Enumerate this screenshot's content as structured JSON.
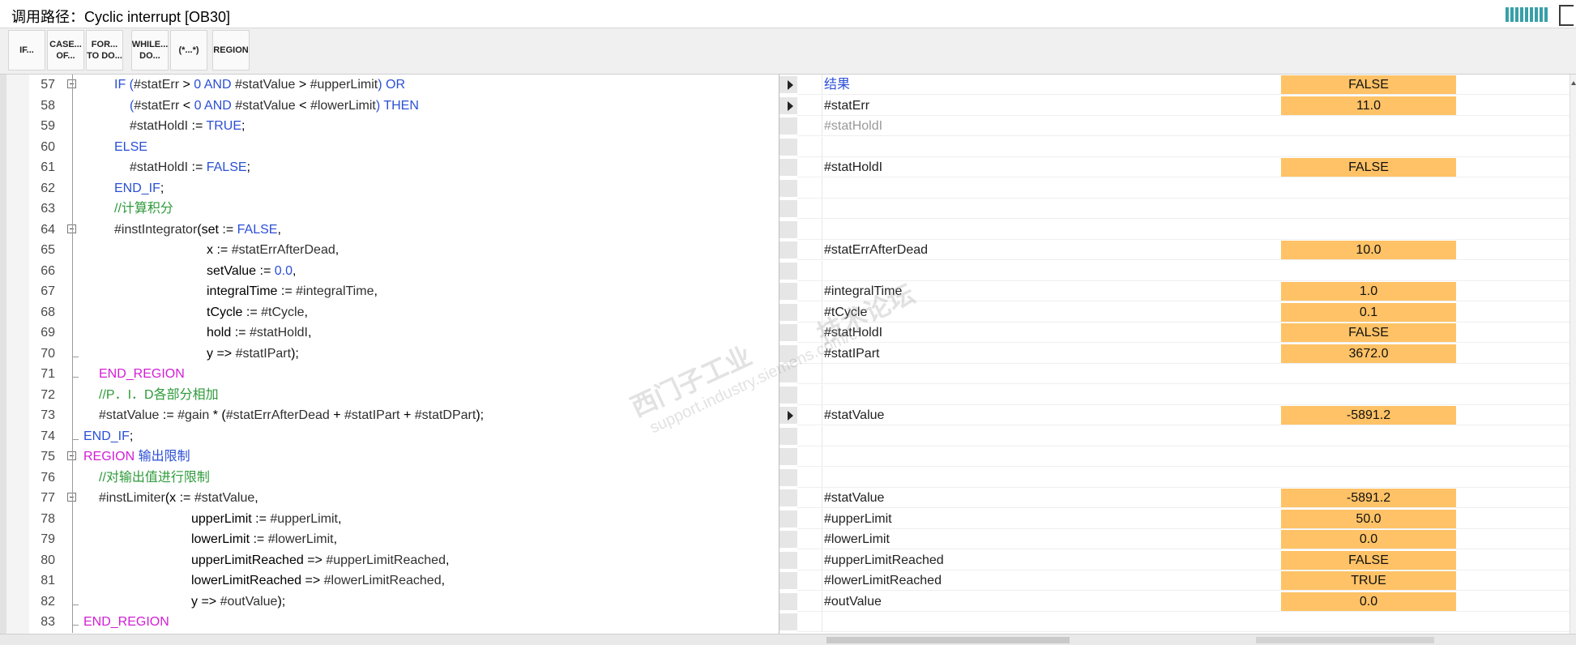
{
  "window": {
    "title": "调用路径：Cyclic interrupt [OB30]"
  },
  "toolbar": {
    "buttons": [
      {
        "line1": "IF...",
        "line2": ""
      },
      {
        "line1": "CASE...",
        "line2": "OF..."
      },
      {
        "line1": "FOR...",
        "line2": "TO DO..."
      },
      {
        "line1": "WHILE...",
        "line2": "DO..."
      },
      {
        "line1": "(*...*)",
        "line2": ""
      },
      {
        "line1": "REGION",
        "line2": ""
      }
    ]
  },
  "code_lines": [
    {
      "num": "57",
      "fold": "box",
      "indent": 3,
      "parts": [
        [
          "kw",
          "IF ("
        ],
        [
          "var",
          "#statErr"
        ],
        [
          "txt",
          " > "
        ],
        [
          "kw",
          "0"
        ],
        [
          "kw",
          " AND "
        ],
        [
          "var",
          "#statValue"
        ],
        [
          "txt",
          " > "
        ],
        [
          "var",
          "#upperLimit"
        ],
        [
          "kw",
          ") OR"
        ]
      ]
    },
    {
      "num": "58",
      "indent": 4,
      "parts": [
        [
          "kw",
          "("
        ],
        [
          "var",
          "#statErr"
        ],
        [
          "txt",
          " < "
        ],
        [
          "kw",
          "0"
        ],
        [
          "kw",
          " AND "
        ],
        [
          "var",
          "#statValue"
        ],
        [
          "txt",
          " < "
        ],
        [
          "var",
          "#lowerLimit"
        ],
        [
          "kw",
          ") THEN"
        ]
      ]
    },
    {
      "num": "59",
      "indent": 4,
      "parts": [
        [
          "var",
          "#statHoldI"
        ],
        [
          "txt",
          " := "
        ],
        [
          "kw",
          "TRUE"
        ],
        [
          "txt",
          ";"
        ]
      ]
    },
    {
      "num": "60",
      "indent": 3,
      "parts": [
        [
          "kw",
          "ELSE"
        ]
      ]
    },
    {
      "num": "61",
      "indent": 4,
      "parts": [
        [
          "var",
          "#statHoldI"
        ],
        [
          "txt",
          " := "
        ],
        [
          "kw",
          "FALSE"
        ],
        [
          "txt",
          ";"
        ]
      ]
    },
    {
      "num": "62",
      "indent": 3,
      "parts": [
        [
          "kw",
          "END_IF"
        ],
        [
          "txt",
          ";"
        ]
      ]
    },
    {
      "num": "63",
      "indent": 3,
      "parts": [
        [
          "cmt",
          "//计算积分"
        ]
      ]
    },
    {
      "num": "64",
      "fold": "box",
      "indent": 3,
      "parts": [
        [
          "var",
          "#instIntegrator"
        ],
        [
          "txt",
          "(set := "
        ],
        [
          "kw",
          "FALSE"
        ],
        [
          "txt",
          ","
        ]
      ]
    },
    {
      "num": "65",
      "indent": 9,
      "parts": [
        [
          "txt",
          "x := "
        ],
        [
          "var",
          "#statErrAfterDead"
        ],
        [
          "txt",
          ","
        ]
      ]
    },
    {
      "num": "66",
      "indent": 9,
      "parts": [
        [
          "txt",
          "setValue := "
        ],
        [
          "kw",
          "0.0"
        ],
        [
          "txt",
          ","
        ]
      ]
    },
    {
      "num": "67",
      "indent": 9,
      "parts": [
        [
          "txt",
          "integralTime := "
        ],
        [
          "var",
          "#integralTime"
        ],
        [
          "txt",
          ","
        ]
      ]
    },
    {
      "num": "68",
      "indent": 9,
      "parts": [
        [
          "txt",
          "tCycle := "
        ],
        [
          "var",
          "#tCycle"
        ],
        [
          "txt",
          ","
        ]
      ]
    },
    {
      "num": "69",
      "indent": 9,
      "parts": [
        [
          "txt",
          "hold := "
        ],
        [
          "var",
          "#statHoldI"
        ],
        [
          "txt",
          ","
        ]
      ]
    },
    {
      "num": "70",
      "fold": "end",
      "indent": 9,
      "parts": [
        [
          "txt",
          "y => "
        ],
        [
          "var",
          "#statIPart"
        ],
        [
          "txt",
          ");"
        ]
      ]
    },
    {
      "num": "71",
      "fold": "end",
      "indent": 2,
      "parts": [
        [
          "reg",
          "END_REGION"
        ]
      ]
    },
    {
      "num": "72",
      "indent": 2,
      "parts": [
        [
          "cmt",
          "//P．I．D各部分相加"
        ]
      ]
    },
    {
      "num": "73",
      "indent": 2,
      "parts": [
        [
          "var",
          "#statValue"
        ],
        [
          "txt",
          " := "
        ],
        [
          "var",
          "#gain"
        ],
        [
          "txt",
          " * ("
        ],
        [
          "var",
          "#statErrAfterDead"
        ],
        [
          "txt",
          " + "
        ],
        [
          "var",
          "#statIPart"
        ],
        [
          "txt",
          " + "
        ],
        [
          "var",
          "#statDPart"
        ],
        [
          "txt",
          ");"
        ]
      ]
    },
    {
      "num": "74",
      "fold": "end",
      "indent": 1,
      "parts": [
        [
          "kw",
          "END_IF"
        ],
        [
          "txt",
          ";"
        ]
      ]
    },
    {
      "num": "75",
      "fold": "box",
      "indent": 1,
      "parts": [
        [
          "reg",
          "REGION"
        ],
        [
          "kw",
          " 输出限制"
        ]
      ]
    },
    {
      "num": "76",
      "indent": 2,
      "parts": [
        [
          "cmt",
          "//对输出值进行限制"
        ]
      ]
    },
    {
      "num": "77",
      "fold": "box",
      "indent": 2,
      "parts": [
        [
          "var",
          "#instLimiter"
        ],
        [
          "txt",
          "(x := "
        ],
        [
          "var",
          "#statValue"
        ],
        [
          "txt",
          ","
        ]
      ]
    },
    {
      "num": "78",
      "indent": 8,
      "parts": [
        [
          "txt",
          "upperLimit := "
        ],
        [
          "var",
          "#upperLimit"
        ],
        [
          "txt",
          ","
        ]
      ]
    },
    {
      "num": "79",
      "indent": 8,
      "parts": [
        [
          "txt",
          "lowerLimit := "
        ],
        [
          "var",
          "#lowerLimit"
        ],
        [
          "txt",
          ","
        ]
      ]
    },
    {
      "num": "80",
      "indent": 8,
      "parts": [
        [
          "txt",
          "upperLimitReached => "
        ],
        [
          "var",
          "#upperLimitReached"
        ],
        [
          "txt",
          ","
        ]
      ]
    },
    {
      "num": "81",
      "indent": 8,
      "parts": [
        [
          "txt",
          "lowerLimitReached => "
        ],
        [
          "var",
          "#lowerLimitReached"
        ],
        [
          "txt",
          ","
        ]
      ]
    },
    {
      "num": "82",
      "fold": "end",
      "indent": 8,
      "parts": [
        [
          "txt",
          "y => "
        ],
        [
          "var",
          "#outValue"
        ],
        [
          "txt",
          ");"
        ]
      ]
    },
    {
      "num": "83",
      "fold": "end",
      "indent": 1,
      "parts": [
        [
          "reg",
          "END_REGION"
        ]
      ]
    }
  ],
  "watch_rows": [
    {
      "arrow": true,
      "name": "结果",
      "name_style": "kw",
      "value": "FALSE"
    },
    {
      "arrow": true,
      "name": "#statErr",
      "value": "11.0"
    },
    {
      "arrow": false,
      "name": "#statHoldI",
      "name_style": "dim",
      "value": ""
    },
    {
      "arrow": false,
      "name": "",
      "value": ""
    },
    {
      "arrow": false,
      "name": "#statHoldI",
      "value": "FALSE"
    },
    {
      "arrow": false,
      "name": "",
      "value": ""
    },
    {
      "arrow": false,
      "name": "",
      "value": ""
    },
    {
      "arrow": false,
      "name": "",
      "value": ""
    },
    {
      "arrow": false,
      "name": "#statErrAfterDead",
      "value": "10.0"
    },
    {
      "arrow": false,
      "name": "",
      "value": ""
    },
    {
      "arrow": false,
      "name": "#integralTime",
      "value": "1.0"
    },
    {
      "arrow": false,
      "name": "#tCycle",
      "value": "0.1"
    },
    {
      "arrow": false,
      "name": "#statHoldI",
      "value": "FALSE"
    },
    {
      "arrow": false,
      "name": "#statIPart",
      "value": "3672.0"
    },
    {
      "arrow": false,
      "name": "",
      "value": ""
    },
    {
      "arrow": false,
      "name": "",
      "value": ""
    },
    {
      "arrow": true,
      "name": "#statValue",
      "value": "-5891.2"
    },
    {
      "arrow": false,
      "name": "",
      "value": ""
    },
    {
      "arrow": false,
      "name": "",
      "value": ""
    },
    {
      "arrow": false,
      "name": "",
      "value": ""
    },
    {
      "arrow": false,
      "name": "#statValue",
      "value": "-5891.2"
    },
    {
      "arrow": false,
      "name": "#upperLimit",
      "value": "50.0"
    },
    {
      "arrow": false,
      "name": "#lowerLimit",
      "value": "0.0"
    },
    {
      "arrow": false,
      "name": "#upperLimitReached",
      "value": "FALSE"
    },
    {
      "arrow": false,
      "name": "#lowerLimitReached",
      "value": "TRUE"
    },
    {
      "arrow": false,
      "name": "#outValue",
      "value": "0.0"
    },
    {
      "arrow": false,
      "name": "",
      "value": ""
    }
  ],
  "watermark": {
    "line1": "西门子工业",
    "line2": "support.industry.siemens.com/cs",
    "line3": "技术论坛"
  },
  "colors": {
    "keyword": "#2b4fd6",
    "comment": "#2e9a3a",
    "region": "#d21ed6",
    "value_bg": "#ffc266"
  }
}
